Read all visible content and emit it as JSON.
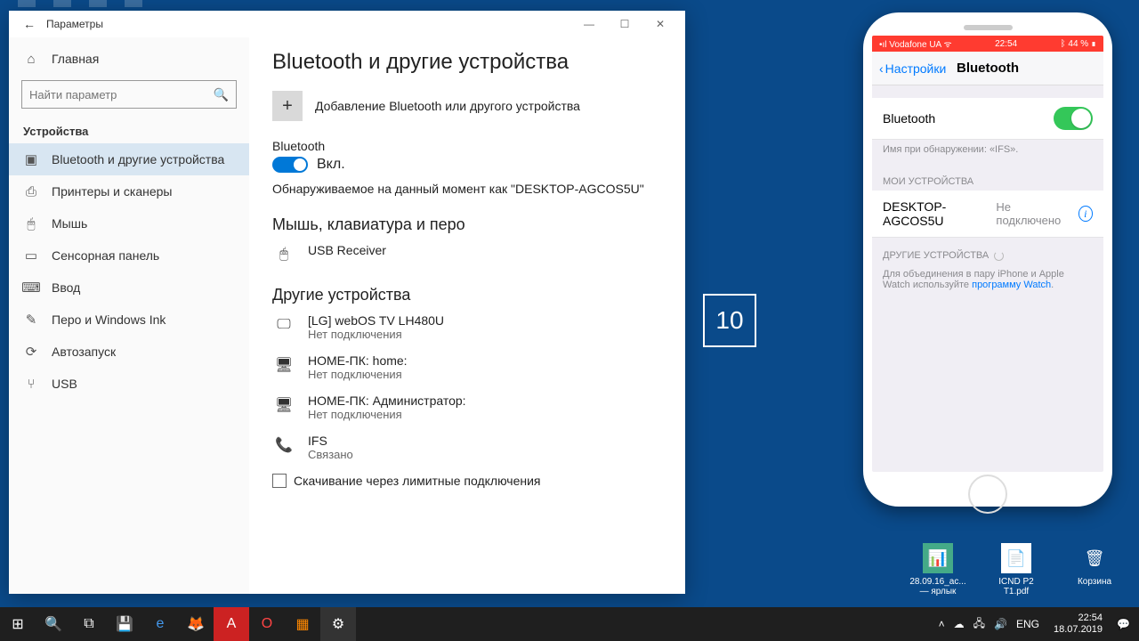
{
  "window": {
    "title": "Параметры",
    "home": "Главная",
    "search_placeholder": "Найти параметр",
    "category": "Устройства",
    "nav": [
      {
        "label": "Bluetooth и другие устройства"
      },
      {
        "label": "Принтеры и сканеры"
      },
      {
        "label": "Мышь"
      },
      {
        "label": "Сенсорная панель"
      },
      {
        "label": "Ввод"
      },
      {
        "label": "Перо и Windows Ink"
      },
      {
        "label": "Автозапуск"
      },
      {
        "label": "USB"
      }
    ],
    "main": {
      "h1": "Bluetooth и другие устройства",
      "add_label": "Добавление Bluetooth или другого устройства",
      "bt_label": "Bluetooth",
      "bt_state": "Вкл.",
      "discoverable": "Обнаруживаемое на данный момент как \"DESKTOP-AGCOS5U\"",
      "h2a": "Мышь, клавиатура и перо",
      "usb_recv": "USB Receiver",
      "h2b": "Другие устройства",
      "devices": [
        {
          "name": "[LG] webOS TV LH480U",
          "status": "Нет подключения"
        },
        {
          "name": "НОМЕ-ПК: home:",
          "status": "Нет подключения"
        },
        {
          "name": "НОМЕ-ПК: Администратор:",
          "status": "Нет подключения"
        },
        {
          "name": "IFS",
          "status": "Связано"
        }
      ],
      "metered": "Скачивание через лимитные подключения"
    }
  },
  "phone": {
    "carrier": "Vodafone UA",
    "time": "22:54",
    "battery": "44 %",
    "back": "Настройки",
    "title": "Bluetooth",
    "bt_cell": "Bluetooth",
    "name_note_pre": "Имя при обнаружении: ",
    "name_value": "«IFS».",
    "my_devices": "МОИ УСТРОЙСТВА",
    "device": "DESKTOP-AGCOS5U",
    "device_status": "Не подключено",
    "other_devices": "ДРУГИЕ УСТРОЙСТВА",
    "pair_note_a": "Для объединения в пару iPhone и Apple Watch используйте ",
    "pair_link": "программу Watch"
  },
  "desktop_icons": [
    {
      "label": "28.09.16_ac... — ярлык"
    },
    {
      "label": "ICND P2 T1.pdf"
    },
    {
      "label": "Корзина"
    }
  ],
  "taskbar": {
    "lang": "ENG",
    "time": "22:54",
    "date": "18.07.2019"
  },
  "logo": "10"
}
